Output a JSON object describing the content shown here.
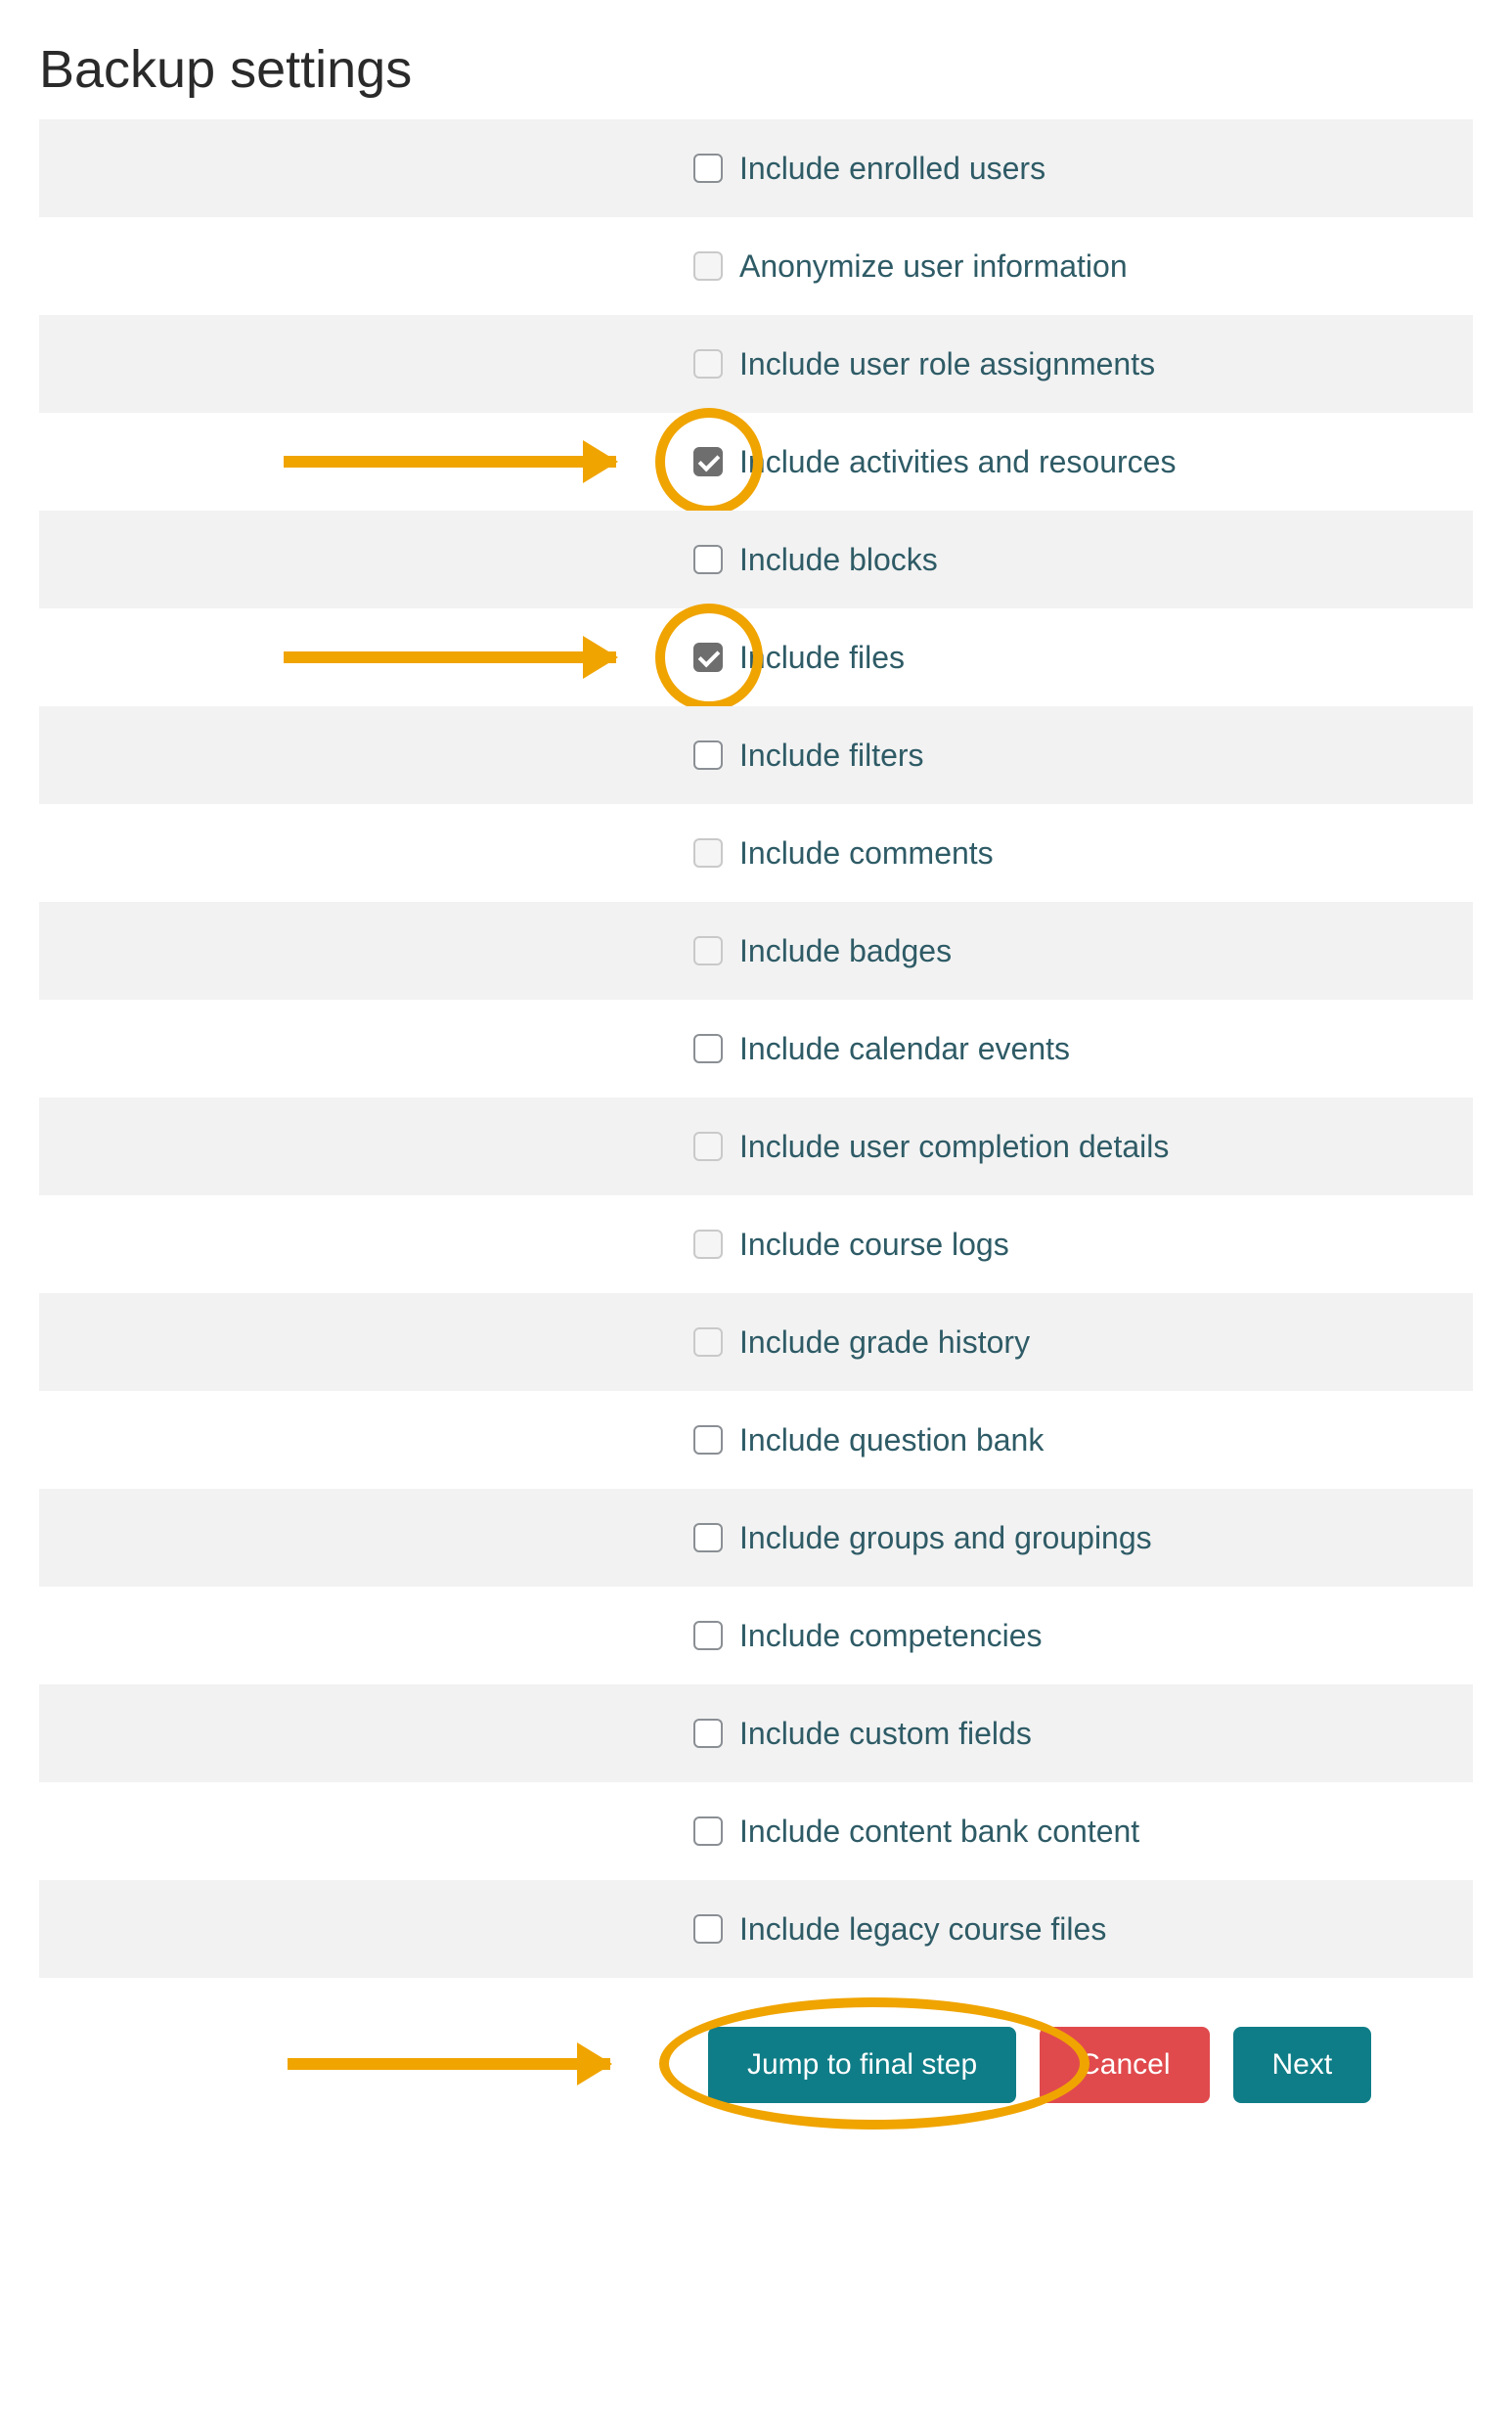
{
  "title": "Backup settings",
  "settings": [
    {
      "label": "Include enrolled users",
      "checked": false,
      "disabled": false,
      "highlighted": false
    },
    {
      "label": "Anonymize user information",
      "checked": false,
      "disabled": true,
      "highlighted": false
    },
    {
      "label": "Include user role assignments",
      "checked": false,
      "disabled": true,
      "highlighted": false
    },
    {
      "label": "Include activities and resources",
      "checked": true,
      "disabled": false,
      "highlighted": true
    },
    {
      "label": "Include blocks",
      "checked": false,
      "disabled": false,
      "highlighted": false
    },
    {
      "label": "Include files",
      "checked": true,
      "disabled": false,
      "highlighted": true
    },
    {
      "label": "Include filters",
      "checked": false,
      "disabled": false,
      "highlighted": false
    },
    {
      "label": "Include comments",
      "checked": false,
      "disabled": true,
      "highlighted": false
    },
    {
      "label": "Include badges",
      "checked": false,
      "disabled": true,
      "highlighted": false
    },
    {
      "label": "Include calendar events",
      "checked": false,
      "disabled": false,
      "highlighted": false
    },
    {
      "label": "Include user completion details",
      "checked": false,
      "disabled": true,
      "highlighted": false
    },
    {
      "label": "Include course logs",
      "checked": false,
      "disabled": true,
      "highlighted": false
    },
    {
      "label": "Include grade history",
      "checked": false,
      "disabled": true,
      "highlighted": false
    },
    {
      "label": "Include question bank",
      "checked": false,
      "disabled": false,
      "highlighted": false
    },
    {
      "label": "Include groups and groupings",
      "checked": false,
      "disabled": false,
      "highlighted": false
    },
    {
      "label": "Include competencies",
      "checked": false,
      "disabled": false,
      "highlighted": false
    },
    {
      "label": "Include custom fields",
      "checked": false,
      "disabled": false,
      "highlighted": false
    },
    {
      "label": "Include content bank content",
      "checked": false,
      "disabled": false,
      "highlighted": false
    },
    {
      "label": "Include legacy course files",
      "checked": false,
      "disabled": false,
      "highlighted": false
    }
  ],
  "buttons": {
    "jump": "Jump to final step",
    "cancel": "Cancel",
    "next": "Next"
  },
  "annotations": {
    "jump_highlighted": true
  }
}
